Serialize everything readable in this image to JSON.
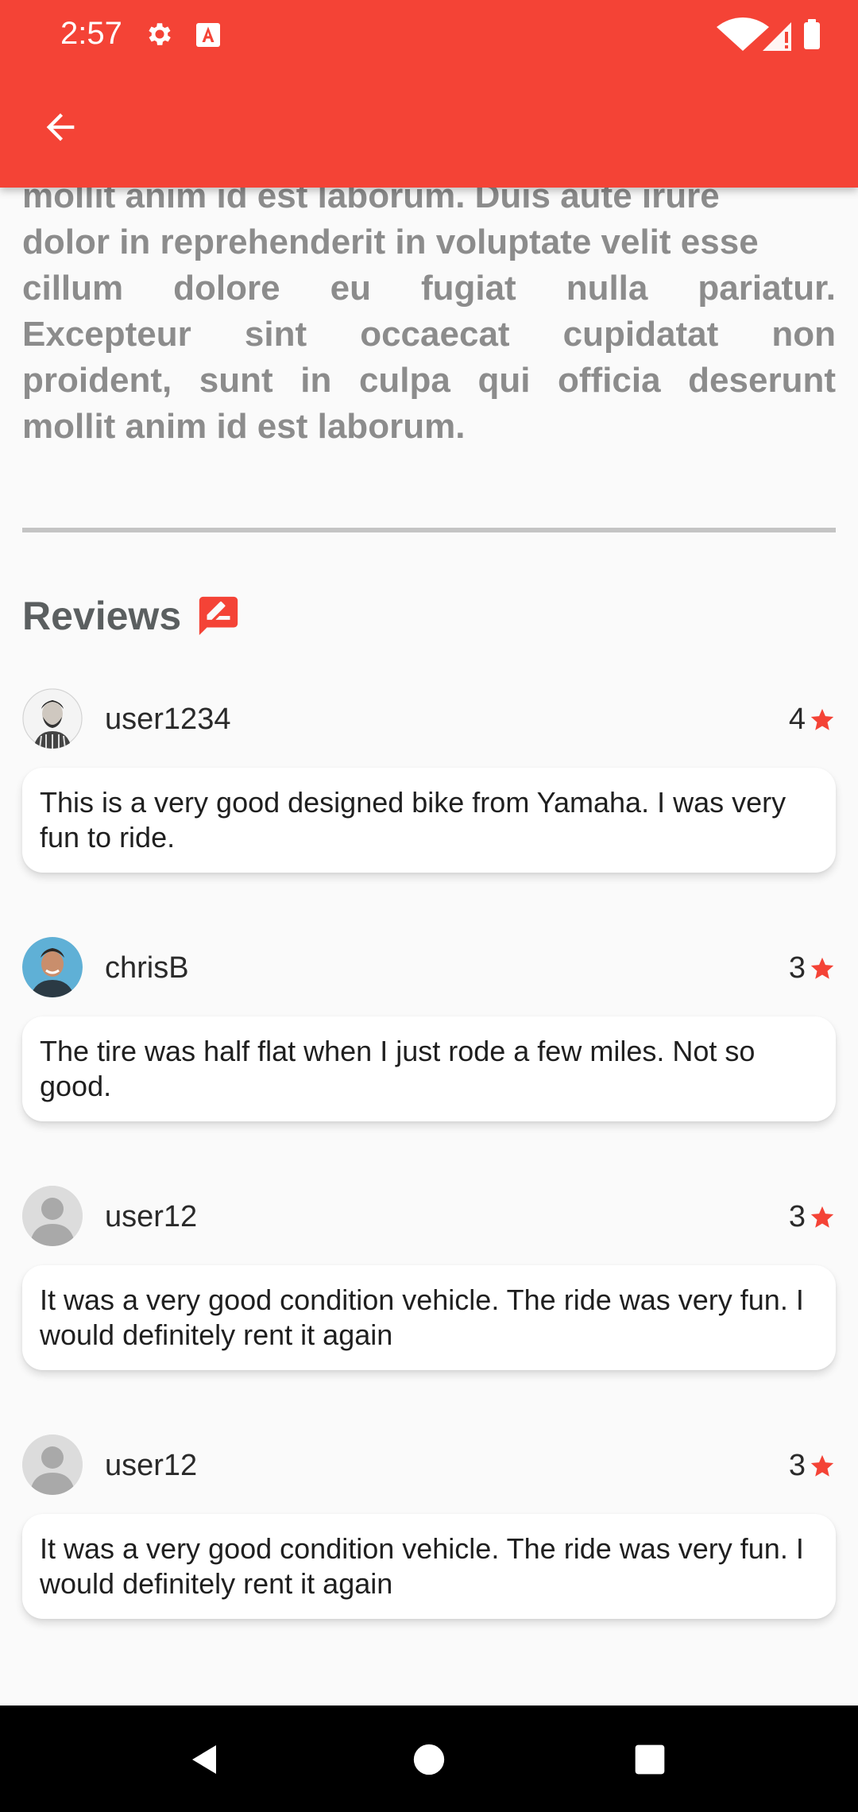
{
  "status_bar": {
    "time": "2:57"
  },
  "colors": {
    "accent": "#f44336",
    "star": "#f44336",
    "muted_text": "#8c8c8c"
  },
  "description": {
    "lines": [
      "mollit anim id est laborum.  Duis aute irure",
      "dolor in reprehenderit in voluptate velit esse",
      "cillum dolore eu fugiat nulla pariatur.",
      "Excepteur sint occaecat cupidatat non",
      "proident, sunt in culpa qui officia deserunt",
      "mollit anim id est laborum."
    ]
  },
  "reviews_section": {
    "title": "Reviews",
    "icon": "rate-review-icon",
    "items": [
      {
        "username": "user1234",
        "rating": "4",
        "text": "This is a very good designed bike from Yamaha. I was very fun to ride.",
        "avatar": "bearded-man-avatar"
      },
      {
        "username": "chrisB",
        "rating": "3",
        "text": "The tire was half flat when I just rode a few miles. Not so good.",
        "avatar": "smiling-man-avatar"
      },
      {
        "username": "user12",
        "rating": "3",
        "text": "It was a very good condition vehicle. The ride was very fun. I would definitely rent it again",
        "avatar": "default-person-avatar"
      },
      {
        "username": "user12",
        "rating": "3",
        "text": "It was a very good condition vehicle. The ride was very fun. I would definitely rent it again",
        "avatar": "default-person-avatar"
      }
    ]
  },
  "nav_bar": {
    "buttons": [
      "back",
      "home",
      "recents"
    ]
  }
}
